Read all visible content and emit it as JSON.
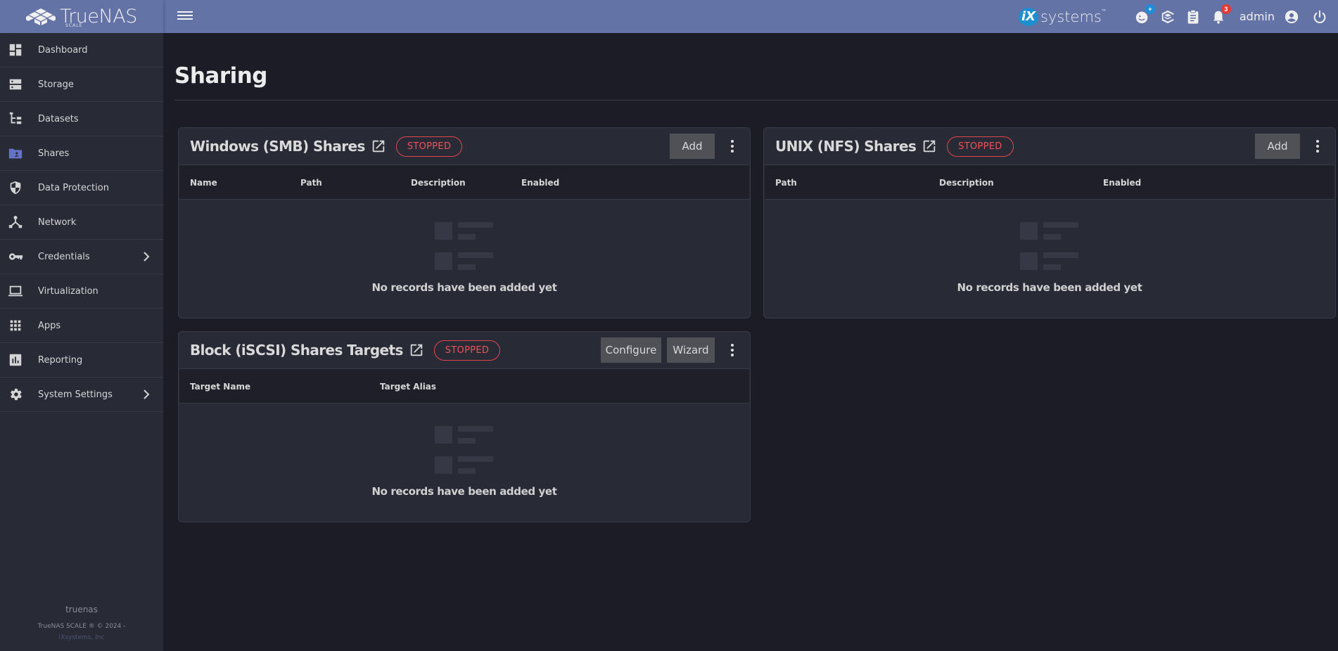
{
  "header": {
    "brand": "TrueNAS",
    "brand_edition": "SCALE",
    "vendor_badge": "iX",
    "vendor_name": "systems",
    "vendor_tm": "™",
    "notification_count": "3",
    "feedback_badge": "+",
    "user": "admin",
    "icons": [
      "menu-icon",
      "feedback-icon",
      "truecommand-icon",
      "jobs-clipboard-icon",
      "notifications-bell-icon",
      "account-circle-icon",
      "power-icon"
    ]
  },
  "sidebar": {
    "items": [
      {
        "label": "Dashboard",
        "icon": "dashboard-icon",
        "active": false
      },
      {
        "label": "Storage",
        "icon": "storage-icon",
        "active": false
      },
      {
        "label": "Datasets",
        "icon": "datasets-icon",
        "active": false
      },
      {
        "label": "Shares",
        "icon": "shares-folder-icon",
        "active": true
      },
      {
        "label": "Data Protection",
        "icon": "shield-icon",
        "active": false
      },
      {
        "label": "Network",
        "icon": "network-icon",
        "active": false
      },
      {
        "label": "Credentials",
        "icon": "key-icon",
        "active": false,
        "expandable": true
      },
      {
        "label": "Virtualization",
        "icon": "laptop-icon",
        "active": false
      },
      {
        "label": "Apps",
        "icon": "apps-grid-icon",
        "active": false
      },
      {
        "label": "Reporting",
        "icon": "reporting-icon",
        "active": false
      },
      {
        "label": "System Settings",
        "icon": "gear-icon",
        "active": false,
        "expandable": true
      }
    ],
    "footer": {
      "hostname": "truenas",
      "copyright": "TrueNAS SCALE ® © 2024 -",
      "company": "iXsystems, Inc"
    }
  },
  "page": {
    "title": "Sharing"
  },
  "colors": {
    "accent": "#6473a6",
    "status_stopped": "#f0525a",
    "active_nav_icon": "#6473c6"
  },
  "cards": {
    "smb": {
      "title": "Windows (SMB) Shares",
      "status": "STOPPED",
      "actions": [
        "Add"
      ],
      "columns": [
        "Name",
        "Path",
        "Description",
        "Enabled"
      ],
      "rows": [],
      "empty_message": "No records have been added yet"
    },
    "nfs": {
      "title": "UNIX (NFS) Shares",
      "status": "STOPPED",
      "actions": [
        "Add"
      ],
      "columns": [
        "Path",
        "Description",
        "Enabled"
      ],
      "rows": [],
      "empty_message": "No records have been added yet"
    },
    "iscsi": {
      "title": "Block (iSCSI) Shares Targets",
      "status": "STOPPED",
      "actions": [
        "Configure",
        "Wizard"
      ],
      "columns": [
        "Target Name",
        "Target Alias"
      ],
      "rows": [],
      "empty_message": "No records have been added yet"
    }
  }
}
